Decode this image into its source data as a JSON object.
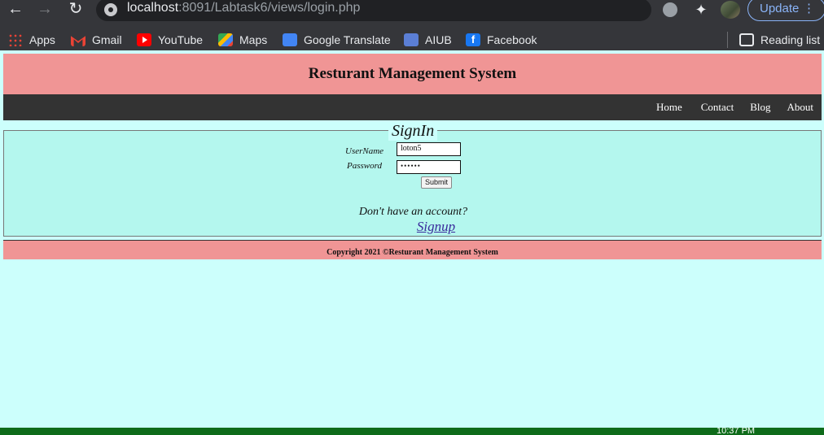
{
  "browser": {
    "url_host": "localhost",
    "url_path": ":8091/Labtask6/views/login.php",
    "update_label": "Update",
    "bookmarks": [
      "Apps",
      "Gmail",
      "YouTube",
      "Maps",
      "Google Translate",
      "AIUB",
      "Facebook"
    ],
    "reading_list": "Reading list"
  },
  "header": {
    "title": "Resturant Management System"
  },
  "nav": {
    "items": [
      "Home",
      "Contact",
      "Blog",
      "About"
    ]
  },
  "signin": {
    "legend": "SignIn",
    "username_label": "UserName",
    "username_value": "loton5",
    "password_label": "Password",
    "password_value": "••••••",
    "submit_label": "Submit",
    "prompt": "Don't have an account?",
    "signup_link": "Signup"
  },
  "footer": {
    "text": "Copyright 2021 ©Resturant Management System"
  },
  "taskbar": {
    "time": "10:37 PM"
  }
}
